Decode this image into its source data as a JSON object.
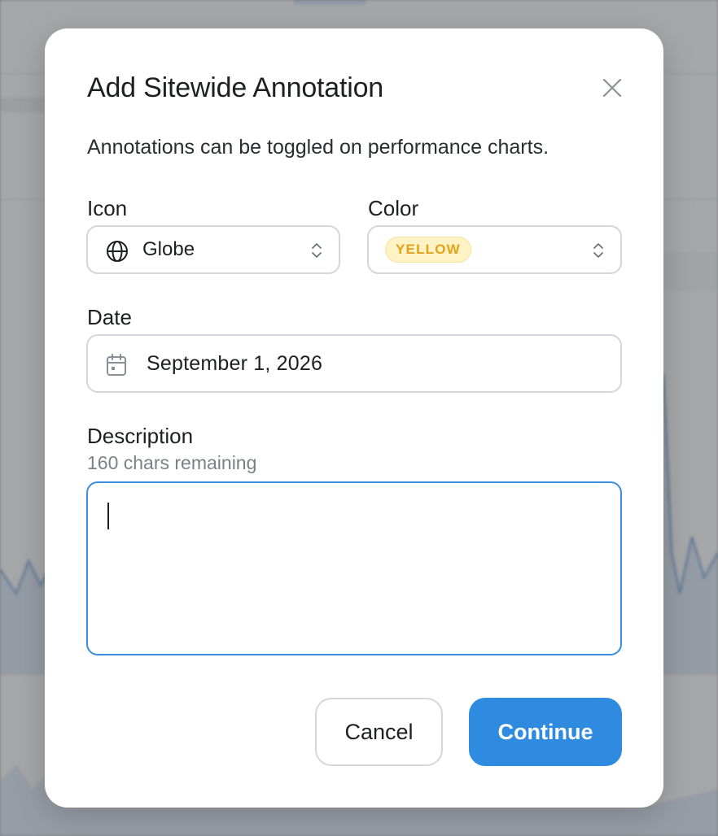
{
  "modal": {
    "title": "Add Sitewide Annotation",
    "subtitle": "Annotations can be toggled on performance charts."
  },
  "icon_field": {
    "label": "Icon",
    "value": "Globe",
    "icon": "globe-icon"
  },
  "color_field": {
    "label": "Color",
    "value": "YELLOW",
    "badge_bg": "#fdf3c4",
    "badge_text": "#e3a21a"
  },
  "date_field": {
    "label": "Date",
    "value": "September 1, 2026",
    "icon": "calendar-icon"
  },
  "description_field": {
    "label": "Description",
    "hint": "160 chars remaining",
    "value": ""
  },
  "actions": {
    "cancel_label": "Cancel",
    "continue_label": "Continue"
  },
  "colors": {
    "accent": "#2f8be0",
    "focus_border": "#3a8ddc"
  }
}
